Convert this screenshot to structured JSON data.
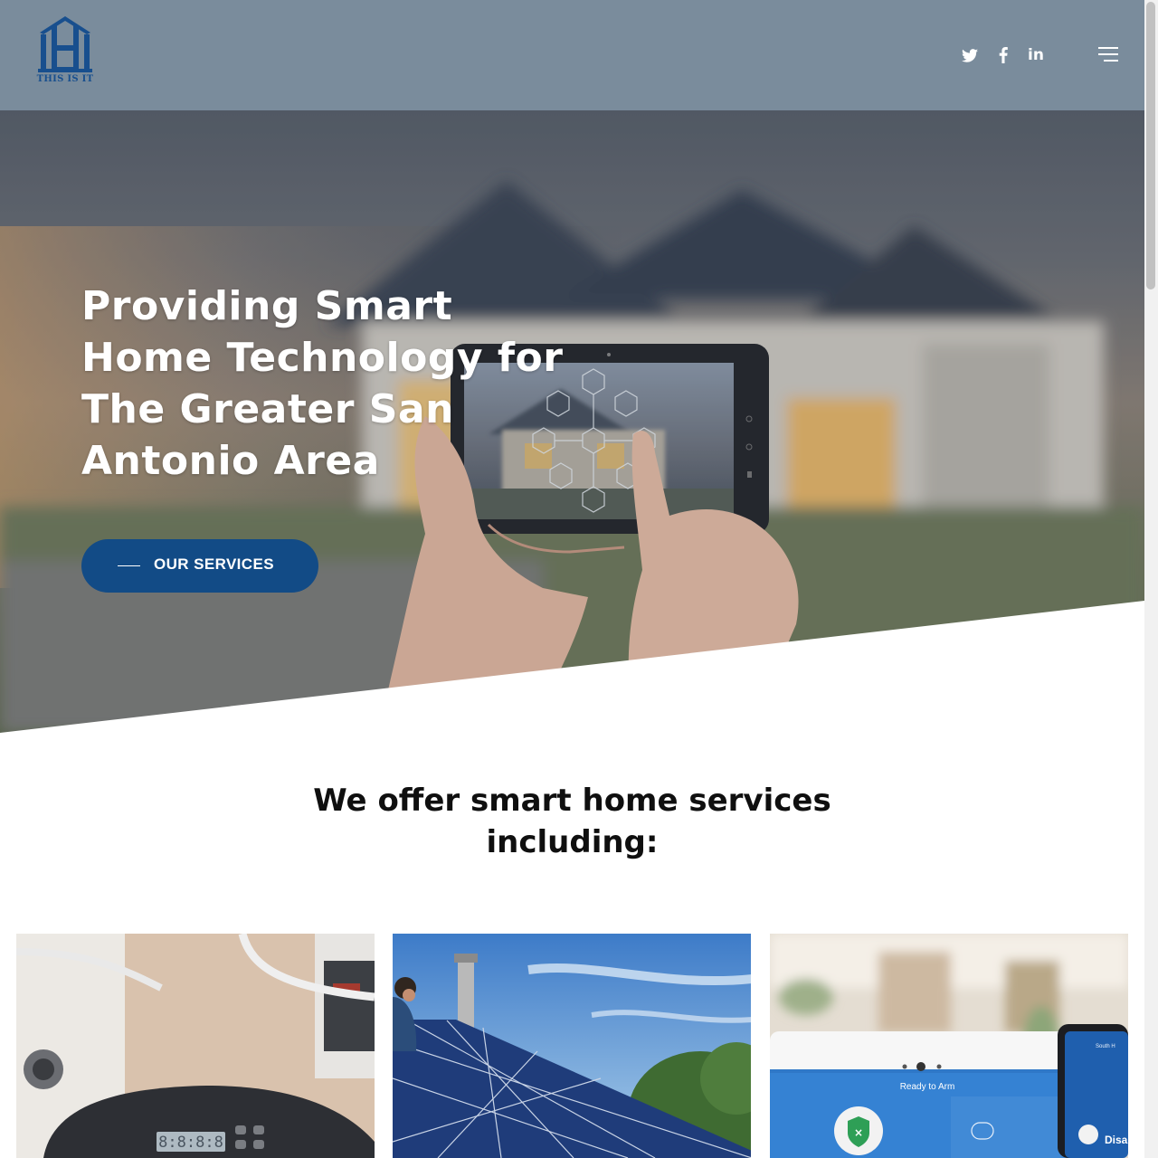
{
  "header": {
    "logo_text": "THIS IS IT",
    "social": {
      "twitter_icon": "twitter-icon",
      "facebook_icon": "facebook-icon",
      "linkedin_label": "in"
    },
    "menu_icon": "hamburger-menu-icon"
  },
  "hero": {
    "title": "Providing Smart Home Technology for The Greater San Antonio Area",
    "cta_label": "OUR SERVICES"
  },
  "services": {
    "heading": "We offer smart home services including:",
    "cards": [
      {
        "image": "water-softener-controller-photo",
        "display_text": "8:8:8:8"
      },
      {
        "image": "solar-panel-installation-photo"
      },
      {
        "image": "security-alarm-panel-photo",
        "panel_text": "Ready to Arm",
        "phone_text_top": "South H",
        "phone_text_bottom": "Disar"
      }
    ]
  },
  "colors": {
    "header_bg": "#7a8c9c",
    "brand_blue": "#124b86",
    "heading_text": "#0f0f0f"
  }
}
